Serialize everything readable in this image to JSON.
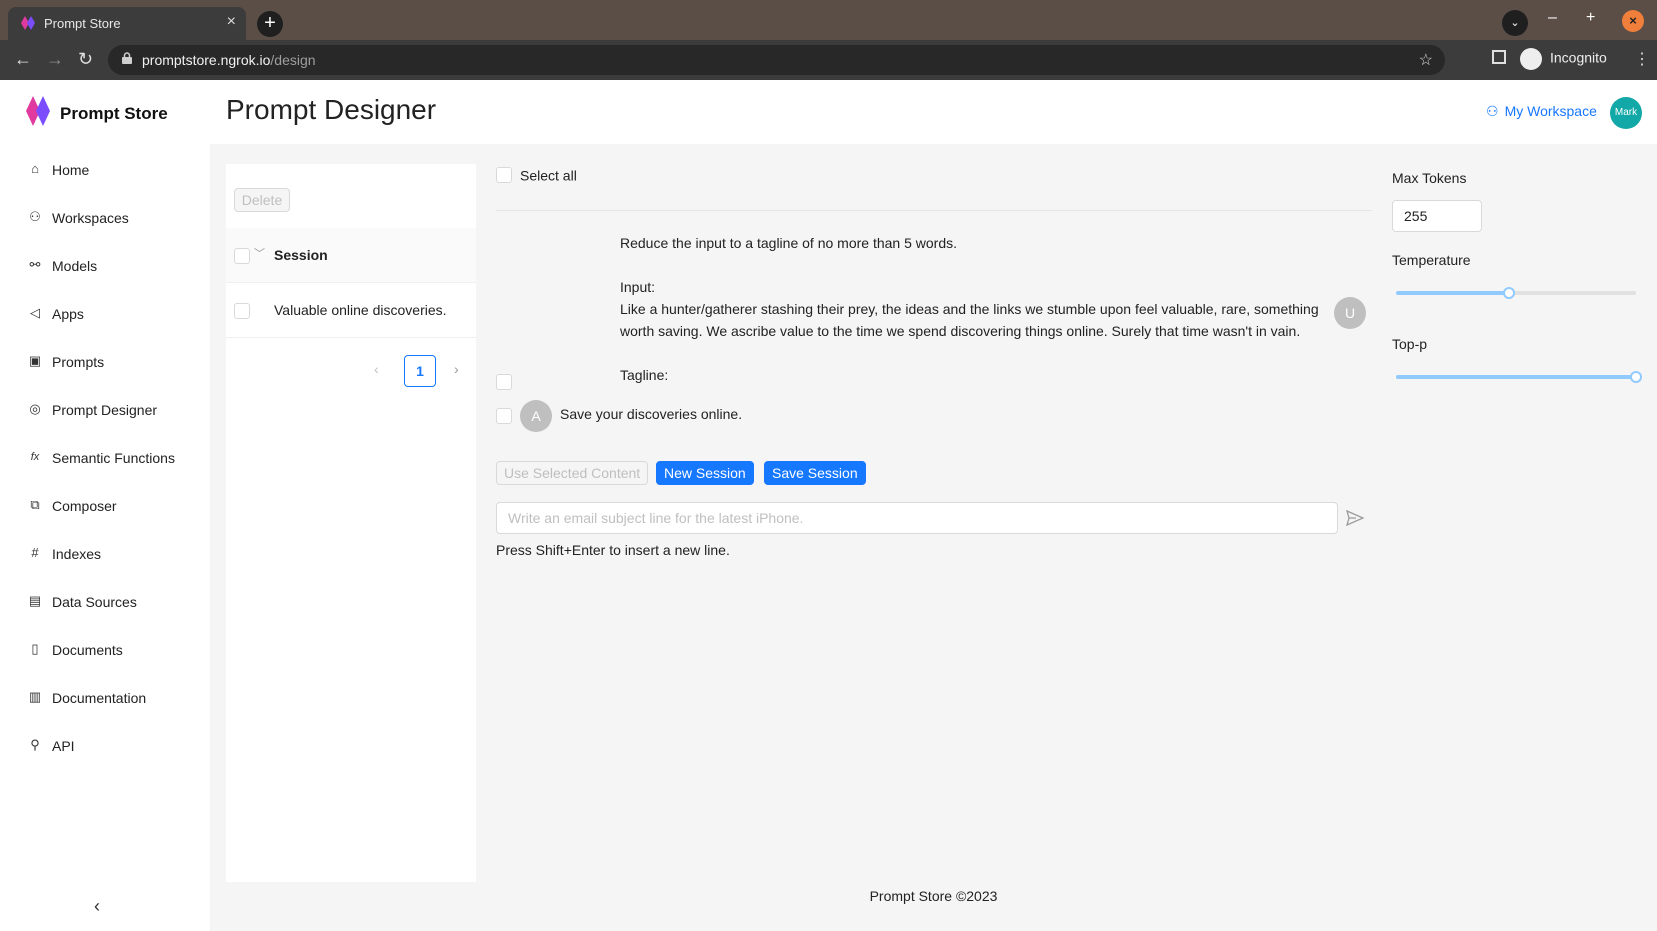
{
  "browser": {
    "tab_title": "Prompt Store",
    "url_host": "promptstore.ngrok.io",
    "url_path": "/design",
    "profile_label": "Incognito"
  },
  "app": {
    "brand": "Prompt Store",
    "page_title": "Prompt Designer",
    "workspace_label": "My Workspace",
    "user_avatar": "Mark",
    "accent_color": "#1677ff"
  },
  "sidebar": {
    "items": [
      {
        "label": "Home",
        "icon": "home-icon"
      },
      {
        "label": "Workspaces",
        "icon": "workspaces-icon"
      },
      {
        "label": "Models",
        "icon": "models-icon"
      },
      {
        "label": "Apps",
        "icon": "apps-icon"
      },
      {
        "label": "Prompts",
        "icon": "prompts-icon"
      },
      {
        "label": "Prompt Designer",
        "icon": "prompt-designer-icon"
      },
      {
        "label": "Semantic Functions",
        "icon": "function-icon"
      },
      {
        "label": "Composer",
        "icon": "composer-icon"
      },
      {
        "label": "Indexes",
        "icon": "indexes-icon"
      },
      {
        "label": "Data Sources",
        "icon": "data-sources-icon"
      },
      {
        "label": "Documents",
        "icon": "documents-icon"
      },
      {
        "label": "Documentation",
        "icon": "documentation-icon"
      },
      {
        "label": "API",
        "icon": "api-icon"
      }
    ]
  },
  "sessions": {
    "delete_label": "Delete",
    "column_header": "Session",
    "rows": [
      "Valuable online discoveries."
    ],
    "current_page": "1"
  },
  "chat": {
    "select_all_label": "Select all",
    "user_message": {
      "line1": "Reduce the input to a tagline of no more than 5 words.",
      "line2": "Input:",
      "line3": "Like a hunter/gatherer stashing their prey, the ideas and the links we stumble upon feel valuable, rare, something worth saving. We ascribe value to the time we spend discovering things online. Surely that time wasn't in vain.",
      "line4": "Tagline:"
    },
    "user_avatar": "U",
    "assistant_avatar": "A",
    "assistant_message": "Save your discoveries online.",
    "buttons": {
      "use_selected": "Use Selected Content",
      "new_session": "New Session",
      "save_session": "Save Session"
    },
    "input_placeholder": "Write an email subject line for the latest iPhone.",
    "hint": "Press Shift+Enter to insert a new line."
  },
  "params": {
    "max_tokens_label": "Max Tokens",
    "max_tokens_value": "255",
    "temperature_label": "Temperature",
    "temperature_fraction": 0.47,
    "top_p_label": "Top-p",
    "top_p_fraction": 1.0
  },
  "footer": "Prompt Store ©2023"
}
